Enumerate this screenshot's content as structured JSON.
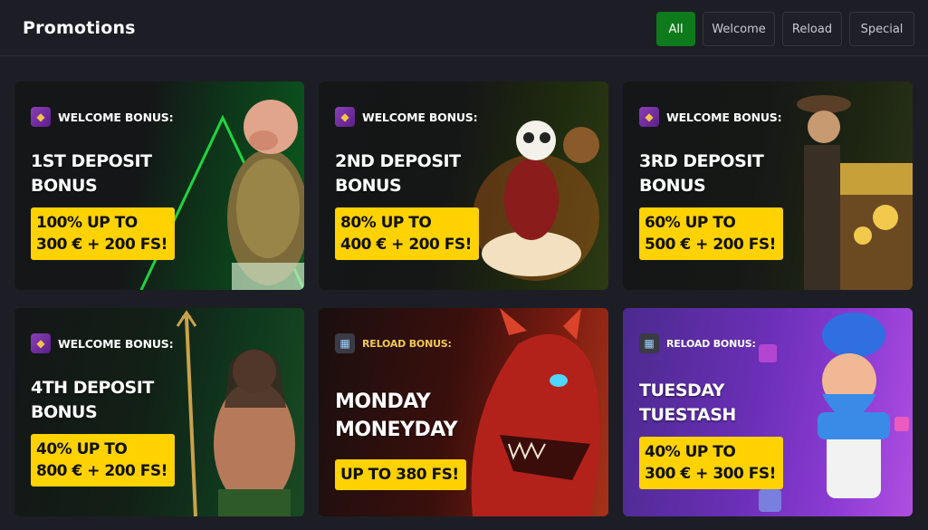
{
  "header": {
    "title": "Promotions"
  },
  "filters": [
    {
      "label": "All",
      "active": true
    },
    {
      "label": "Welcome",
      "active": false
    },
    {
      "label": "Reload",
      "active": false
    },
    {
      "label": "Special",
      "active": false
    }
  ],
  "cards": [
    {
      "tag": "WELCOME BONUS:",
      "icon": "gem-icon",
      "title_line1": "1ST DEPOSIT",
      "title_line2": "BONUS",
      "offer_line1": "100% UP TO",
      "offer_line2": "300 € + 200 FS!",
      "art": "businessman-character"
    },
    {
      "tag": "WELCOME BONUS:",
      "icon": "gem-icon",
      "title_line1": "2ND DEPOSIT",
      "title_line2": "BONUS",
      "offer_line1": "80% UP TO",
      "offer_line2": "400 € + 200 FS!",
      "art": "panda-monkey-character"
    },
    {
      "tag": "WELCOME BONUS:",
      "icon": "gem-icon",
      "title_line1": "3RD DEPOSIT",
      "title_line2": "BONUS",
      "offer_line1": "60% UP TO",
      "offer_line2": "500 € + 200 FS!",
      "art": "explorer-treasure-character"
    },
    {
      "tag": "WELCOME BONUS:",
      "icon": "gem-icon",
      "title_line1": "4TH DEPOSIT",
      "title_line2": "BONUS",
      "offer_line1": "40% UP TO",
      "offer_line2": "800 € + 200 FS!",
      "art": "sea-king-character"
    },
    {
      "tag": "RELOAD BONUS:",
      "icon": "gift-icon",
      "title_line1": "MONDAY",
      "title_line2": "MONEYDAY",
      "offer_line1": "UP TO 380 FS!",
      "art": "red-dragon-character"
    },
    {
      "tag": "RELOAD BONUS:",
      "icon": "gift-icon",
      "title_line1": "TUESDAY",
      "title_line2": "TUESTASH",
      "offer_line1": "40% UP TO",
      "offer_line2": "300 € + 300 FS!",
      "art": "chef-character"
    }
  ],
  "colors": {
    "accent_green": "#0f7a1c",
    "badge_yellow": "#ffd200",
    "background": "#1d1e25"
  }
}
